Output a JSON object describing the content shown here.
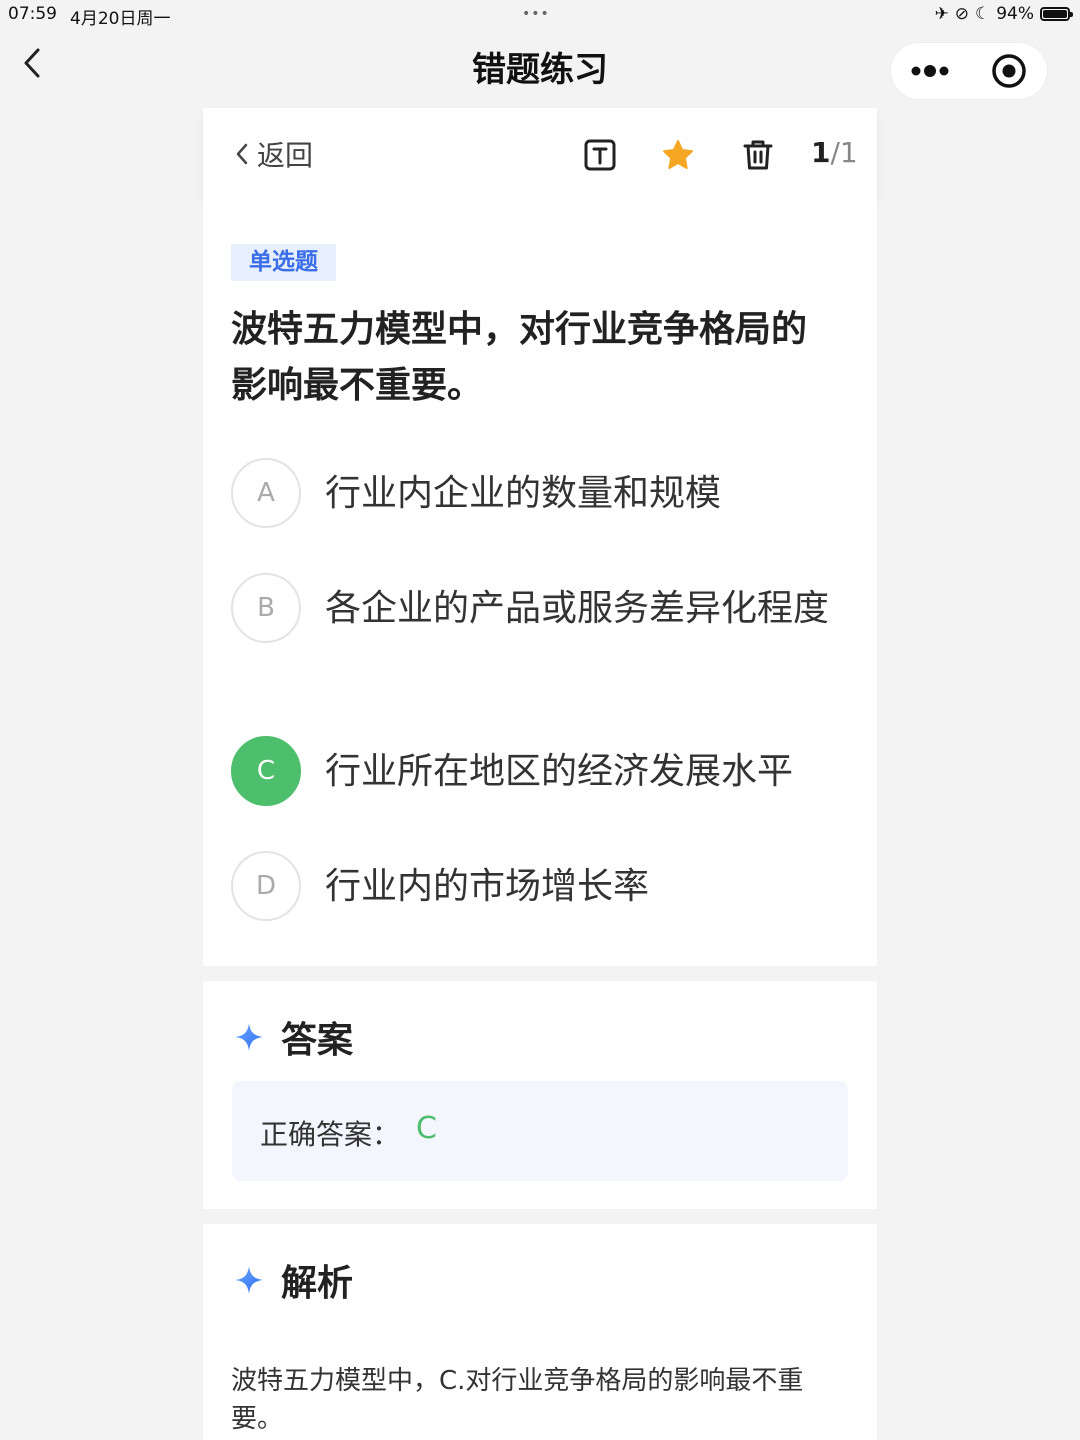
{
  "status_bar": {
    "time": "07:59",
    "date": "4月20日周一",
    "dots": "•••",
    "battery": "94%",
    "battery_level": 0.94
  },
  "nav": {
    "title": "错题练习",
    "back_icon": "chevron-left-icon",
    "more_icon": "more-dots-icon",
    "target_icon": "target-icon"
  },
  "toolbar": {
    "back_label": "返回",
    "count_current": "1",
    "count_sep": "/",
    "count_total": "1",
    "icons": [
      "text-box-icon",
      "star-icon",
      "trash-icon"
    ],
    "star_color": "#f5a623"
  },
  "question": {
    "type_badge": "单选题",
    "text": "波特五力模型中，对行业竞争格局的影响最不重要。",
    "options": [
      {
        "letter": "A",
        "text": "行业内企业的数量和规模",
        "correct": false
      },
      {
        "letter": "B",
        "text": "各企业的产品或服务差异化程度",
        "correct": false
      },
      {
        "letter": "C",
        "text": "行业所在地区的经济发展水平",
        "correct": true
      },
      {
        "letter": "D",
        "text": "行业内的市场增长率",
        "correct": false
      }
    ]
  },
  "answer": {
    "title": "答案",
    "label": "正确答案：",
    "value": "C"
  },
  "analysis": {
    "title": "解析",
    "text": "波特五力模型中，C.对行业竞争格局的影响最不重要。"
  },
  "colors": {
    "accent_blue": "#3a6ee8",
    "correct_green": "#4dbe6b",
    "badge_bg": "#e7eefc"
  }
}
